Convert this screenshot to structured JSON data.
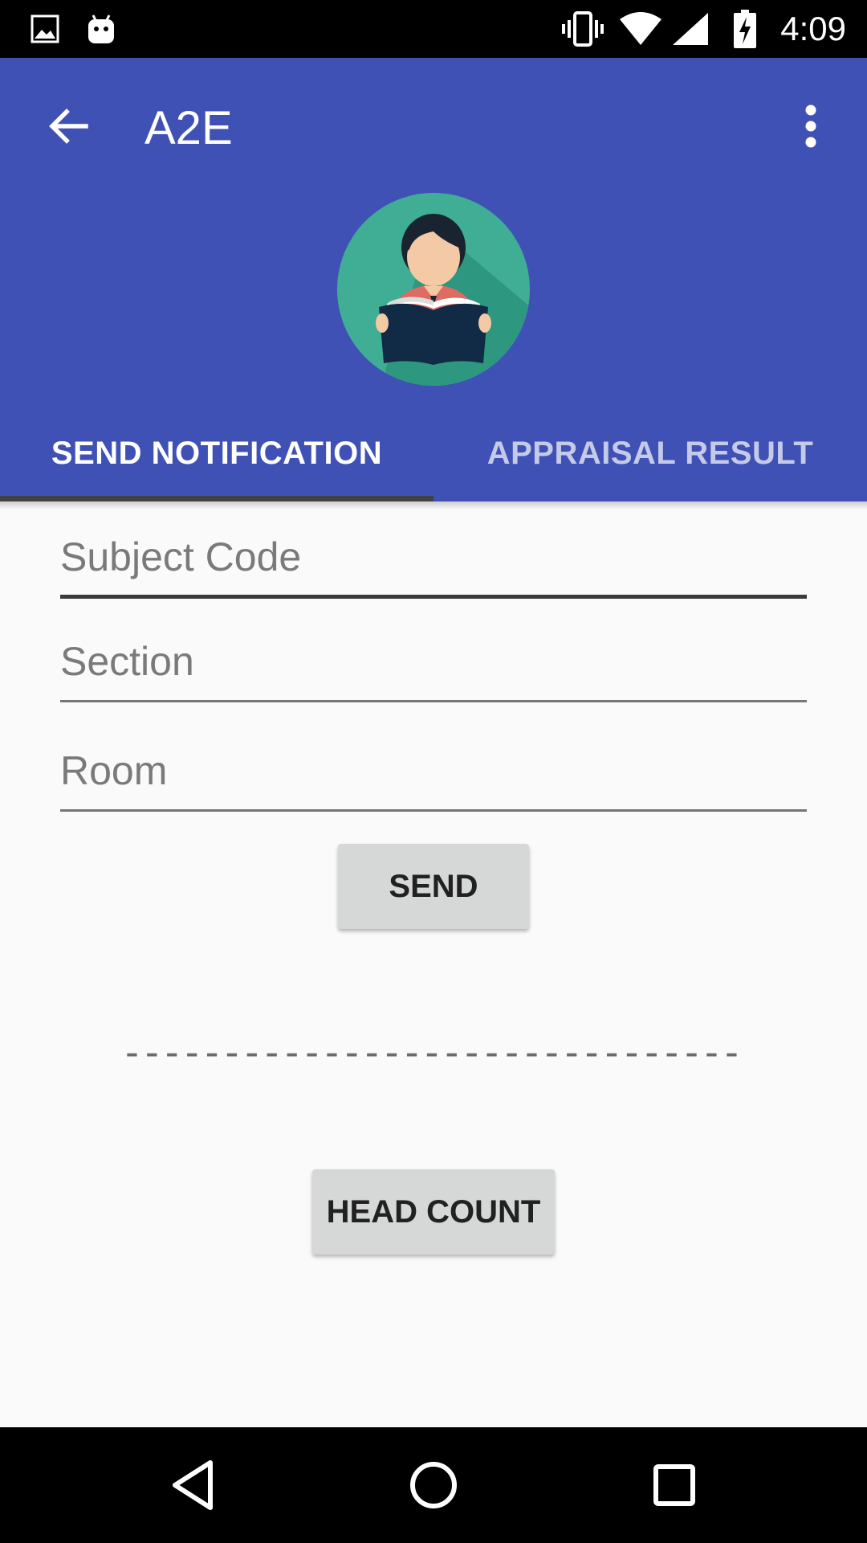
{
  "status_bar": {
    "time": "4:09",
    "left_icons": [
      "image-icon",
      "android-icon"
    ],
    "right_icons": [
      "vibrate-icon",
      "wifi-icon",
      "signal-icon",
      "battery-charging-icon"
    ]
  },
  "app_bar": {
    "title": "A2E",
    "back_icon": "arrow-back-icon",
    "menu_icon": "more-vert-icon",
    "color": "#3f51b5"
  },
  "tabs": [
    {
      "label": "SEND NOTIFICATION",
      "active": true
    },
    {
      "label": "APPRAISAL RESULT",
      "active": false
    }
  ],
  "form": {
    "subject_code_placeholder": "Subject Code",
    "section_placeholder": "Section",
    "room_placeholder": "Room",
    "send_label": "SEND",
    "dashes": "-----------------------------------",
    "head_count_label": "HEAD COUNT"
  },
  "nav_bar": {
    "icons": [
      "nav-back-icon",
      "nav-home-icon",
      "nav-recents-icon"
    ]
  }
}
